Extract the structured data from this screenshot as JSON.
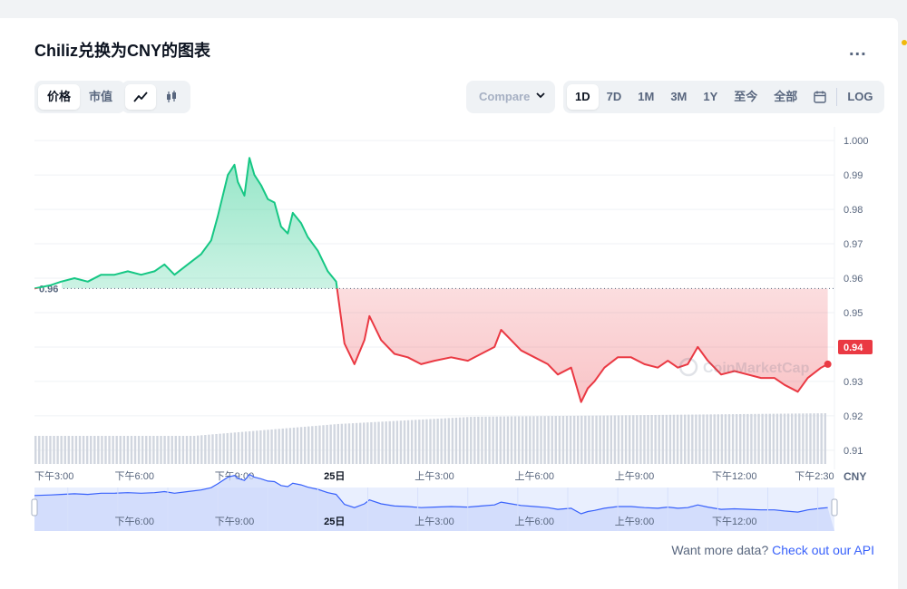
{
  "title": "Chiliz兑换为CNY的图表",
  "more_label": "...",
  "type_tabs": [
    {
      "label": "价格",
      "active": true
    },
    {
      "label": "市值",
      "active": false
    }
  ],
  "view_icons": [
    {
      "name": "line-chart-icon",
      "active": true
    },
    {
      "name": "candlestick-icon",
      "active": false
    }
  ],
  "compare_label": "Compare",
  "ranges": [
    {
      "label": "1D",
      "active": true
    },
    {
      "label": "7D",
      "active": false
    },
    {
      "label": "1M",
      "active": false
    },
    {
      "label": "3M",
      "active": false
    },
    {
      "label": "1Y",
      "active": false
    },
    {
      "label": "至今",
      "active": false
    },
    {
      "label": "全部",
      "active": false
    }
  ],
  "log_label": "LOG",
  "footer": {
    "text": "Want more data?",
    "link": "Check out our API"
  },
  "watermark": "CoinMarketCap",
  "colors": {
    "up": "#16c784",
    "down": "#ea3943",
    "accent": "#3861fb"
  },
  "chart_data": {
    "type": "area",
    "quote_currency": "CNY",
    "baseline": 0.957,
    "baseline_label": "0.96",
    "current_label": "0.94",
    "ylim": [
      0.906,
      1.004
    ],
    "y_ticks": [
      "1.000",
      "0.99",
      "0.98",
      "0.97",
      "0.96",
      "0.95",
      "0.94",
      "0.93",
      "0.92",
      "0.91"
    ],
    "y_tick_values": [
      1.0,
      0.99,
      0.98,
      0.97,
      0.96,
      0.95,
      0.94,
      0.93,
      0.92,
      0.91
    ],
    "x_ticks": [
      {
        "label": "下午3:00",
        "t": 0,
        "bold": false
      },
      {
        "label": "下午6:00",
        "t": 3,
        "bold": false
      },
      {
        "label": "下午9:00",
        "t": 6,
        "bold": false
      },
      {
        "label": "25日",
        "t": 9,
        "bold": true
      },
      {
        "label": "上午3:00",
        "t": 12,
        "bold": false
      },
      {
        "label": "上午6:00",
        "t": 15,
        "bold": false
      },
      {
        "label": "上午9:00",
        "t": 18,
        "bold": false
      },
      {
        "label": "下午12:00",
        "t": 21,
        "bold": false
      },
      {
        "label": "下午2:30",
        "t": 23.5,
        "bold": false
      }
    ],
    "x_range_hours": [
      0,
      24
    ],
    "navigator_ticks": [
      {
        "label": "下午6:00",
        "t": 3,
        "bold": false
      },
      {
        "label": "下午9:00",
        "t": 6,
        "bold": false
      },
      {
        "label": "25日",
        "t": 9,
        "bold": true
      },
      {
        "label": "上午3:00",
        "t": 12,
        "bold": false
      },
      {
        "label": "上午6:00",
        "t": 15,
        "bold": false
      },
      {
        "label": "上午9:00",
        "t": 18,
        "bold": false
      },
      {
        "label": "下午12:00",
        "t": 21,
        "bold": false
      }
    ],
    "price": [
      [
        0.0,
        0.957
      ],
      [
        0.5,
        0.958
      ],
      [
        0.8,
        0.959
      ],
      [
        1.2,
        0.96
      ],
      [
        1.6,
        0.959
      ],
      [
        2.0,
        0.961
      ],
      [
        2.4,
        0.961
      ],
      [
        2.8,
        0.962
      ],
      [
        3.2,
        0.961
      ],
      [
        3.6,
        0.962
      ],
      [
        3.9,
        0.964
      ],
      [
        4.2,
        0.961
      ],
      [
        4.6,
        0.964
      ],
      [
        5.0,
        0.967
      ],
      [
        5.3,
        0.971
      ],
      [
        5.5,
        0.978
      ],
      [
        5.8,
        0.99
      ],
      [
        6.0,
        0.993
      ],
      [
        6.1,
        0.988
      ],
      [
        6.3,
        0.984
      ],
      [
        6.45,
        0.995
      ],
      [
        6.6,
        0.99
      ],
      [
        6.8,
        0.987
      ],
      [
        7.0,
        0.983
      ],
      [
        7.2,
        0.982
      ],
      [
        7.4,
        0.975
      ],
      [
        7.6,
        0.973
      ],
      [
        7.75,
        0.979
      ],
      [
        8.0,
        0.976
      ],
      [
        8.2,
        0.972
      ],
      [
        8.5,
        0.968
      ],
      [
        8.8,
        0.962
      ],
      [
        9.05,
        0.959
      ],
      [
        9.3,
        0.941
      ],
      [
        9.6,
        0.935
      ],
      [
        9.9,
        0.942
      ],
      [
        10.05,
        0.949
      ],
      [
        10.4,
        0.942
      ],
      [
        10.8,
        0.938
      ],
      [
        11.2,
        0.937
      ],
      [
        11.6,
        0.935
      ],
      [
        12.0,
        0.936
      ],
      [
        12.5,
        0.937
      ],
      [
        13.0,
        0.936
      ],
      [
        13.4,
        0.938
      ],
      [
        13.8,
        0.94
      ],
      [
        14.0,
        0.945
      ],
      [
        14.3,
        0.942
      ],
      [
        14.6,
        0.939
      ],
      [
        15.0,
        0.937
      ],
      [
        15.4,
        0.935
      ],
      [
        15.7,
        0.932
      ],
      [
        16.1,
        0.934
      ],
      [
        16.4,
        0.924
      ],
      [
        16.6,
        0.928
      ],
      [
        16.8,
        0.93
      ],
      [
        17.1,
        0.934
      ],
      [
        17.5,
        0.937
      ],
      [
        17.9,
        0.937
      ],
      [
        18.3,
        0.935
      ],
      [
        18.7,
        0.934
      ],
      [
        19.0,
        0.936
      ],
      [
        19.3,
        0.934
      ],
      [
        19.6,
        0.935
      ],
      [
        19.9,
        0.94
      ],
      [
        20.2,
        0.936
      ],
      [
        20.6,
        0.932
      ],
      [
        21.0,
        0.933
      ],
      [
        21.4,
        0.932
      ],
      [
        21.8,
        0.931
      ],
      [
        22.2,
        0.931
      ],
      [
        22.5,
        0.929
      ],
      [
        22.9,
        0.927
      ],
      [
        23.2,
        0.931
      ],
      [
        23.6,
        0.934
      ],
      [
        23.8,
        0.935
      ]
    ]
  }
}
